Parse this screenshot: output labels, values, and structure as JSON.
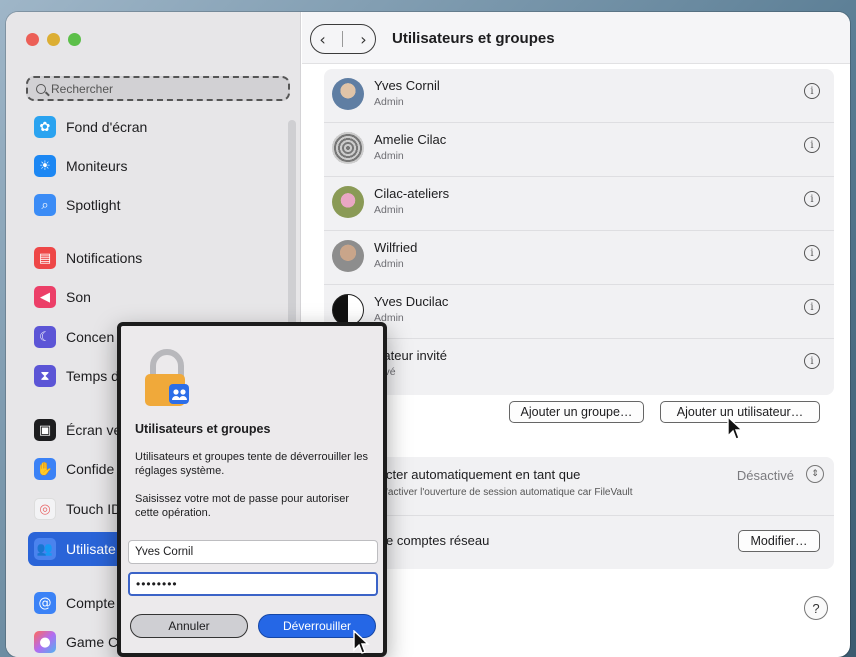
{
  "window": {
    "title": "Utilisateurs et groupes"
  },
  "sidebar": {
    "search_placeholder": "Rechercher",
    "items": [
      {
        "label": "Fond d'écran",
        "icon": "wallpaper-icon",
        "color": "#2aa3f0"
      },
      {
        "label": "Moniteurs",
        "icon": "displays-icon",
        "color": "#1c87f3"
      },
      {
        "label": "Spotlight",
        "icon": "spotlight-icon",
        "color": "#3b8cf6"
      },
      {
        "label": "Notifications",
        "icon": "notifications-icon",
        "color": "#ee4747"
      },
      {
        "label": "Son",
        "icon": "sound-icon",
        "color": "#ec3f68"
      },
      {
        "label": "Concen",
        "icon": "focus-icon",
        "color": "#5c55d6"
      },
      {
        "label": "Temps d",
        "icon": "screen-time-icon",
        "color": "#5c55d6"
      },
      {
        "label": "Écran ve",
        "icon": "lock-screen-icon",
        "color": "#1d1d1f"
      },
      {
        "label": "Confide",
        "icon": "privacy-icon",
        "color": "#3b82f6"
      },
      {
        "label": "Touch ID",
        "icon": "touch-id-icon",
        "color": "#f3f3f5"
      },
      {
        "label": "Utilisate",
        "icon": "users-icon",
        "color": "#2a64d8"
      },
      {
        "label": "Compte",
        "icon": "internet-accounts-icon",
        "color": "#3b82f6"
      },
      {
        "label": "Game C",
        "icon": "game-center-icon",
        "color": "#ff6a5a"
      }
    ]
  },
  "users": [
    {
      "name": "Yves Cornil",
      "role": "Admin"
    },
    {
      "name": "Amelie Cilac",
      "role": "Admin"
    },
    {
      "name": "Cilac-ateliers",
      "role": "Admin"
    },
    {
      "name": "Wilfried",
      "role": "Admin"
    },
    {
      "name": "Yves Ducilac",
      "role": "Admin"
    },
    {
      "name": "isateur invité",
      "role": "ctivé"
    }
  ],
  "buttons": {
    "add_group": "Ajouter un groupe…",
    "add_user": "Ajouter un utilisateur…",
    "modify": "Modifier…",
    "help": "?"
  },
  "auto_login": {
    "title": "cter automatiquement en tant que",
    "value": "Désactivé",
    "note": "'activer l'ouverture de session automatique car FileVault"
  },
  "network_accounts": {
    "title": "e comptes réseau"
  },
  "dialog": {
    "title": "Utilisateurs et groupes",
    "text1": "Utilisateurs et groupes tente de déverrouiller les réglages système.",
    "text2": "Saisissez votre mot de passe pour autoriser cette opération.",
    "username": "Yves Cornil",
    "password": "••••••••",
    "cancel": "Annuler",
    "unlock": "Déverrouiller"
  }
}
